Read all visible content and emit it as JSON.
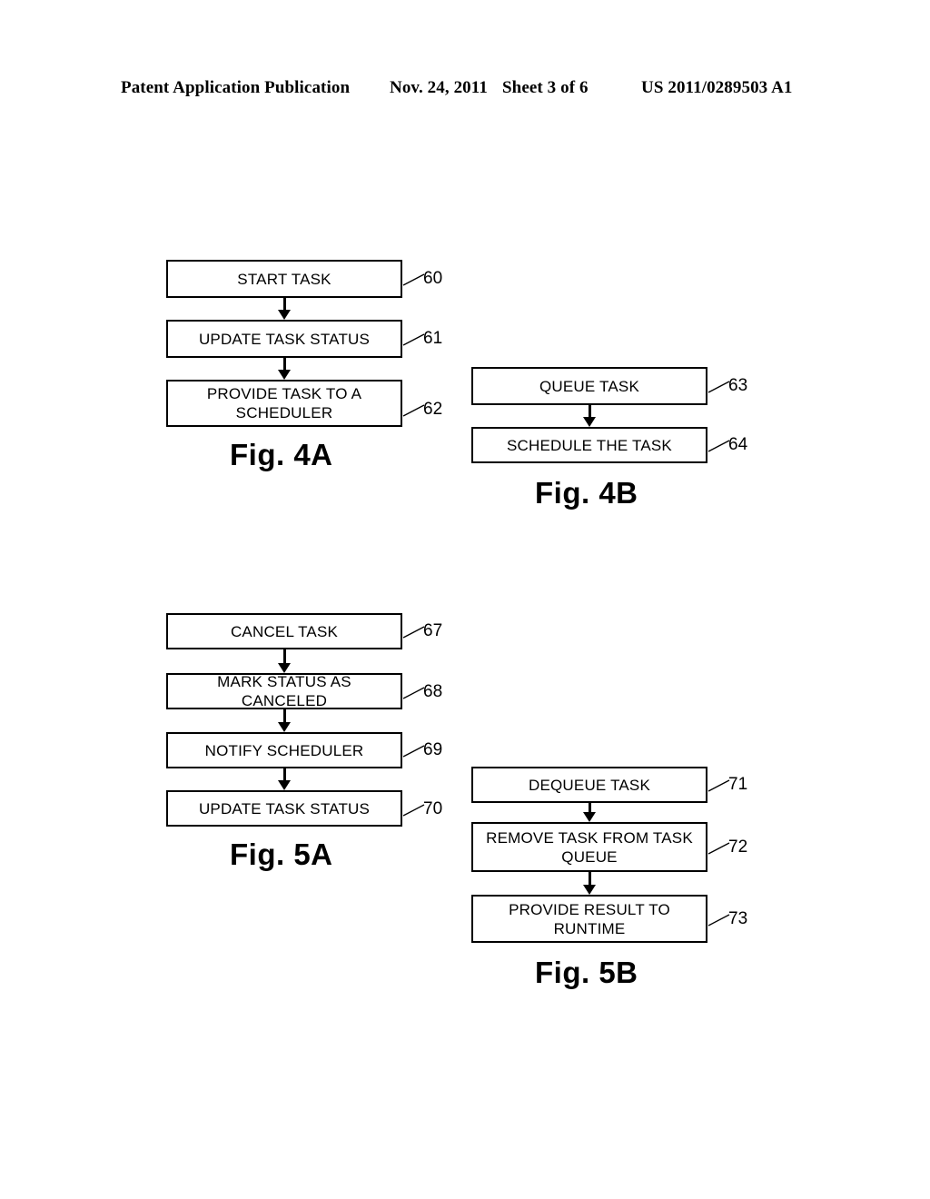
{
  "header": {
    "publication": "Patent Application Publication",
    "date": "Nov. 24, 2011",
    "sheet": "Sheet 3 of 6",
    "patent_number": "US 2011/0289503 A1"
  },
  "figures": [
    {
      "caption": "Fig. 4A",
      "steps": [
        {
          "label": "START TASK",
          "ref": "60"
        },
        {
          "label": "UPDATE TASK STATUS",
          "ref": "61"
        },
        {
          "label": "PROVIDE TASK TO A SCHEDULER",
          "ref": "62"
        }
      ]
    },
    {
      "caption": "Fig. 4B",
      "steps": [
        {
          "label": "QUEUE TASK",
          "ref": "63"
        },
        {
          "label": "SCHEDULE THE TASK",
          "ref": "64"
        }
      ]
    },
    {
      "caption": "Fig. 5A",
      "steps": [
        {
          "label": "CANCEL TASK",
          "ref": "67"
        },
        {
          "label": "MARK STATUS AS CANCELED",
          "ref": "68"
        },
        {
          "label": "NOTIFY SCHEDULER",
          "ref": "69"
        },
        {
          "label": "UPDATE TASK STATUS",
          "ref": "70"
        }
      ]
    },
    {
      "caption": "Fig. 5B",
      "steps": [
        {
          "label": "DEQUEUE TASK",
          "ref": "71"
        },
        {
          "label": "REMOVE TASK FROM TASK QUEUE",
          "ref": "72"
        },
        {
          "label": "PROVIDE RESULT TO RUNTIME",
          "ref": "73"
        }
      ]
    }
  ],
  "colors": {
    "ink": "#000000",
    "paper": "#ffffff"
  }
}
